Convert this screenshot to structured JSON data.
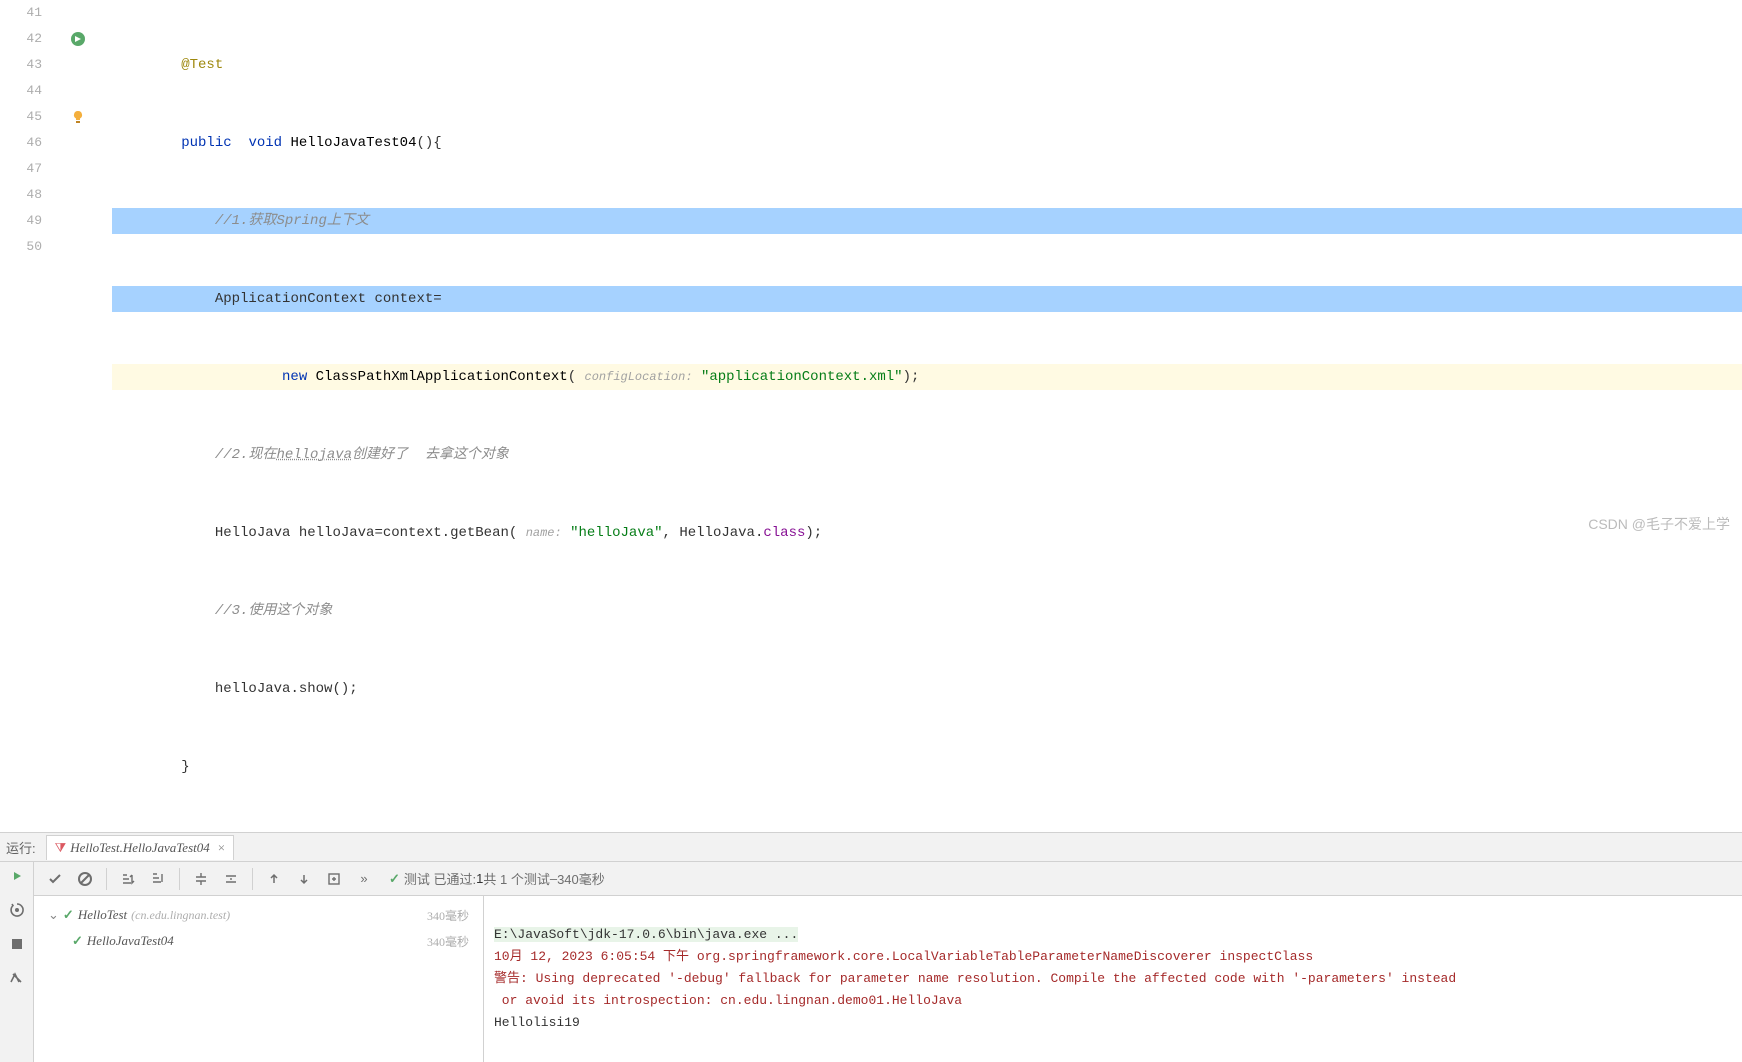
{
  "gutter": [
    "41",
    "42",
    "43",
    "44",
    "45",
    "46",
    "47",
    "48",
    "49",
    "50"
  ],
  "code": {
    "l41_ann": "@Test",
    "l42_kw1": "public",
    "l42_kw2": "void",
    "l42_name": "HelloJavaTest04",
    "l42_tail": "(){",
    "l43_cmt": "//1.获取Spring上下文",
    "l44_a": "ApplicationContext context=",
    "l45_kw": "new",
    "l45_cls": "ClassPathXmlApplicationContext",
    "l45_hint": "configLocation:",
    "l45_str": "\"applicationContext.xml\"",
    "l45_tail": ");",
    "l46_a": "//2.现在",
    "l46_link": "hellojava",
    "l46_b": "创建好了  去拿这个对象",
    "l47_a": "HelloJava helloJava=context.getBean(",
    "l47_hint": "name:",
    "l47_str": "\"helloJava\"",
    "l47_b": ", HelloJava.",
    "l47_ident": "class",
    "l47_c": ");",
    "l48_cmt": "//3.使用这个对象",
    "l49": "helloJava.show();",
    "l50": "}"
  },
  "panel": {
    "run_label": "运行:",
    "tab_label": "HelloTest.HelloJavaTest04"
  },
  "status": {
    "prefix": "测试 已通过:",
    "count": "1",
    "middle": "共 1 个测试",
    "dash": " – ",
    "time": "340毫秒"
  },
  "tree": {
    "root": "HelloTest",
    "root_pkg": "(cn.edu.lingnan.test)",
    "root_dur": "340毫秒",
    "child": "HelloJavaTest04",
    "child_dur": "340毫秒"
  },
  "console": {
    "l1": "E:\\JavaSoft\\jdk-17.0.6\\bin\\java.exe ...",
    "l2": "10月 12, 2023 6:05:54 下午 org.springframework.core.LocalVariableTableParameterNameDiscoverer inspectClass",
    "l3": "警告: Using deprecated '-debug' fallback for parameter name resolution. Compile the affected code with '-parameters' instead",
    "l4": " or avoid its introspection: cn.edu.lingnan.demo01.HelloJava",
    "l5": "Hellolisi19"
  },
  "watermark": "CSDN @毛子不爱上学"
}
